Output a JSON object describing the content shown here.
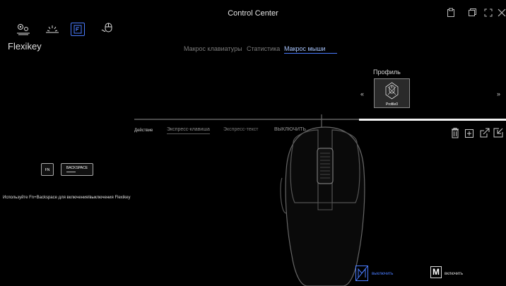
{
  "window": {
    "title": "Control Center"
  },
  "nav": {
    "icons": [
      "settings-icon",
      "lighting-icon",
      "flexikey-icon",
      "mouse-icon"
    ]
  },
  "app": {
    "title": "Flexikey"
  },
  "tabs": [
    {
      "label": "Макрос клавиатуры",
      "active": false
    },
    {
      "label": "Статистика",
      "active": false
    },
    {
      "label": "Макрос мыши",
      "active": true
    }
  ],
  "profile": {
    "label": "Профиль",
    "name": "Profile0",
    "prev": "«",
    "next": "»"
  },
  "action": {
    "label": "Действие",
    "options": [
      "Экспресс-клавиша",
      "Экспресс-текст",
      "ВЫКЛЮЧИТЬ"
    ]
  },
  "keys": {
    "fn": "FN",
    "backspace": "BACKSPACE"
  },
  "hint": {
    "text": "Используйте Fn+Backspace для включения/выключения Flexikey"
  },
  "bottom": {
    "off_label": "выключить",
    "on_label": "включить",
    "on_letter": "M"
  },
  "colors": {
    "accent": "#a9c6ff",
    "active_blue": "#4a7cff",
    "background": "#000000"
  }
}
